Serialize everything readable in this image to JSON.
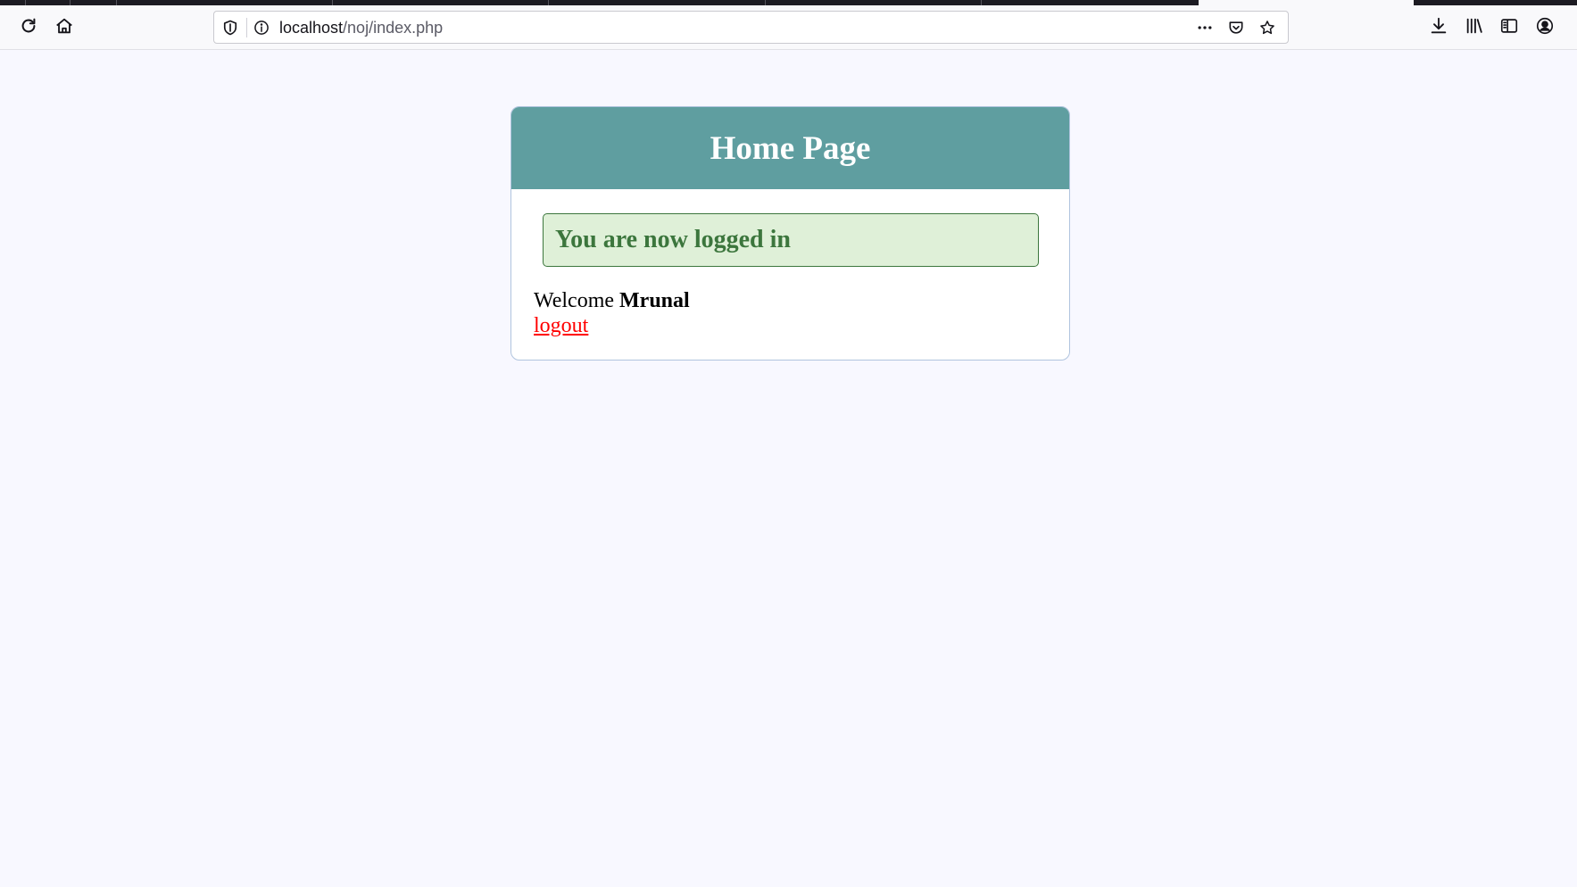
{
  "browser": {
    "url_host": "localhost",
    "url_path": "/noj/index.php",
    "icons": {
      "reload": "reload-icon",
      "home": "home-icon",
      "shield": "tracking-protection-shield-icon",
      "site_info": "site-info-icon",
      "more": "more-actions-icon",
      "pocket": "pocket-icon",
      "bookmark": "bookmark-star-icon",
      "downloads": "downloads-icon",
      "library": "library-icon",
      "sidebar": "sidebar-icon",
      "account": "account-icon"
    }
  },
  "page": {
    "header_title": "Home Page",
    "success_message": "You are now logged in",
    "welcome_prefix": "Welcome",
    "username": "Mrunal",
    "logout_label": "logout"
  },
  "colors": {
    "header_bg": "#5f9ea0",
    "alert_bg": "#dff0d8",
    "alert_text": "#3c763d",
    "link": "#ff0000",
    "page_bg": "#f8f8ff"
  }
}
